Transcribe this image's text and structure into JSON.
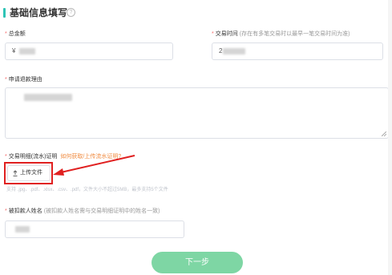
{
  "section": {
    "title": "基础信息填写",
    "help_icon": "question-circle-icon",
    "accent": "#2ec4b6"
  },
  "fields": {
    "total_amount": {
      "required_mark": "*",
      "label": "总金额",
      "currency": "¥"
    },
    "trade_time": {
      "required_mark": "*",
      "label": "交易时间",
      "hint": "(存在有多笔交易时以最早一笔交易时间为准)",
      "value_prefix": "2"
    },
    "refund_reason": {
      "required_mark": "*",
      "label": "申请退款理由"
    },
    "proof": {
      "required_mark": "*",
      "label": "交易明细(流水)证明",
      "link": "如何获取/上传流水证明?",
      "upload_label": "上传文件",
      "upload_hint": "支持 .jpg、.pdf、.xlsx、.csv、.pdf，文件大小不超过5MB，最多支持5个文件"
    },
    "payer_name": {
      "required_mark": "*",
      "label": "被扣款人姓名",
      "hint": "(被扣款人姓名需与交易明细证明中的姓名一致)"
    }
  },
  "actions": {
    "next_label": "下一步"
  },
  "colors": {
    "required": "#f56c6c",
    "link": "#f08a3e",
    "next_button": "#7ed6a4",
    "highlight": "#e02020"
  }
}
